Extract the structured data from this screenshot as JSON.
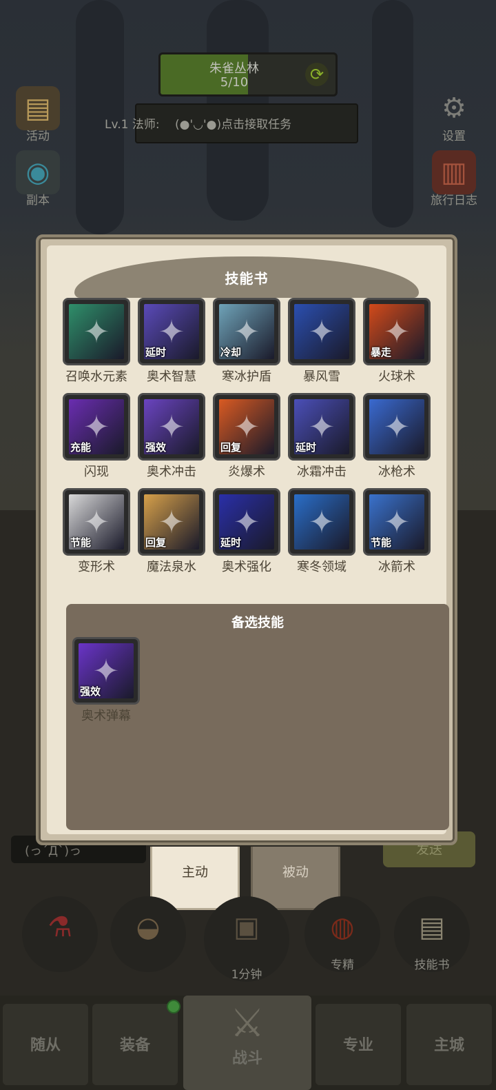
{
  "hud": {
    "zone_name": "朱雀丛林",
    "zone_progress_text": "5/10",
    "zone_progress": 0.5,
    "level_label": "Lv.1 法师:",
    "quest_text": "(●'◡'●)点击接取任务"
  },
  "side_left": [
    {
      "label": "活动",
      "icon": "event-board-icon"
    },
    {
      "label": "副本",
      "icon": "dungeon-portal-icon"
    }
  ],
  "side_right": [
    {
      "label": "设置",
      "icon": "gear-icon"
    },
    {
      "label": "旅行日志",
      "icon": "journal-icon"
    }
  ],
  "skill_book": {
    "title": "技能书",
    "skills": [
      {
        "name": "召唤水元素",
        "tag": "",
        "icon": "water-elemental-icon",
        "color": "#2f8f6a"
      },
      {
        "name": "奥术智慧",
        "tag": "延时",
        "icon": "arcane-eye-icon",
        "color": "#5a4ab8"
      },
      {
        "name": "寒冰护盾",
        "tag": "冷却",
        "icon": "ice-skull-icon",
        "color": "#6fa3b8"
      },
      {
        "name": "暴风雪",
        "tag": "",
        "icon": "blizzard-shards-icon",
        "color": "#2b4fb0"
      },
      {
        "name": "火球术",
        "tag": "暴走",
        "icon": "fireball-icon",
        "color": "#d24a1a"
      },
      {
        "name": "闪现",
        "tag": "充能",
        "icon": "blink-icon",
        "color": "#6a2db0"
      },
      {
        "name": "奥术冲击",
        "tag": "强效",
        "icon": "arcane-web-icon",
        "color": "#6a44c0"
      },
      {
        "name": "炎爆术",
        "tag": "回复",
        "icon": "pyroblast-icon",
        "color": "#d95a22"
      },
      {
        "name": "冰霜冲击",
        "tag": "延时",
        "icon": "frost-shock-icon",
        "color": "#4b4fb8"
      },
      {
        "name": "冰枪术",
        "tag": "",
        "icon": "ice-lance-icon",
        "color": "#3a6ad0"
      },
      {
        "name": "变形术",
        "tag": "节能",
        "icon": "polymorph-cat-icon",
        "color": "#d8d8d8"
      },
      {
        "name": "魔法泉水",
        "tag": "回复",
        "icon": "mana-bread-icon",
        "color": "#d6a04a"
      },
      {
        "name": "奥术强化",
        "tag": "延时",
        "icon": "arcane-lightning-icon",
        "color": "#2a2fa8"
      },
      {
        "name": "寒冬领域",
        "tag": "",
        "icon": "winter-wave-icon",
        "color": "#2a6ec8"
      },
      {
        "name": "冰箭术",
        "tag": "节能",
        "icon": "frostbolt-icon",
        "color": "#3a72cc"
      }
    ],
    "alternate_title": "备选技能",
    "alternate_skills": [
      {
        "name": "奥术弹幕",
        "tag": "强效",
        "icon": "arcane-barrage-icon",
        "color": "#6a34c8"
      }
    ]
  },
  "tabs": {
    "active": "主动",
    "passive": "被动"
  },
  "chat": {
    "text": "(っ´Д`)っ",
    "send": "发送"
  },
  "actions": [
    {
      "label": "",
      "icon": "potion-icon"
    },
    {
      "label": "",
      "icon": "bread-icon"
    },
    {
      "label": "1分钟",
      "icon": "treasure-chest-icon"
    },
    {
      "label": "专精",
      "icon": "specialization-icon"
    },
    {
      "label": "技能书",
      "icon": "skill-book-icon"
    }
  ],
  "nav": {
    "items": [
      "随从",
      "装备",
      "战斗",
      "专业",
      "主城"
    ]
  }
}
